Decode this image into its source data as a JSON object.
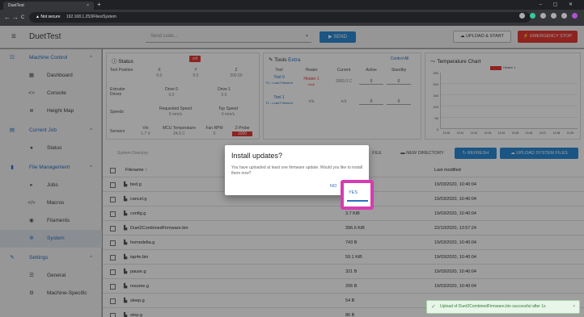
{
  "browser": {
    "tab_title": "DuetTest",
    "tab_close": "×",
    "new_tab": "+",
    "window_controls": "– ▢ ✕",
    "nav_back": "←",
    "nav_forward": "→",
    "nav_reload": "C",
    "security": "▲ Not secure",
    "url": "192.168.1.253/Files/System"
  },
  "header": {
    "menu": "≡",
    "title": "DuetTest",
    "gcode_placeholder": "Send code...",
    "gcode_caret": "▾",
    "send_label": "▶ SEND",
    "upload_start_label": "☁ UPLOAD & START",
    "estop_label": "⚡ EMERGENCY STOP"
  },
  "sidebar": {
    "machine_control": "Machine Control",
    "dashboard": "Dashboard",
    "console": "Console",
    "height_map": "Height Map",
    "current_job": "Current Job",
    "status": "Status",
    "file_management": "File Management",
    "jobs": "Jobs",
    "macros": "Macros",
    "filaments": "Filaments",
    "system": "System",
    "settings": "Settings",
    "general": "General",
    "machine_specific": "Machine-Specific",
    "chev": "^"
  },
  "status_panel": {
    "title": "Status",
    "badge": "Off",
    "tool_position": "Tool Position",
    "x": "X",
    "y": "Y",
    "z": "Z",
    "x_val": "0.0",
    "y_val": "0.0",
    "z_val": "200.00",
    "extruder_drives": "Extruder Drives",
    "drive0": "Drive 0",
    "drive1": "Drive 1",
    "drive0_val": "0.0",
    "drive1_val": "0.0",
    "speeds": "Speeds",
    "requested_speed": "Requested Speed",
    "top_speed": "Top Speed",
    "req_val": "0 mm/s",
    "top_val": "0 mm/s",
    "sensors": "Sensors",
    "vin": "Vin",
    "mcu": "MCU Temperature",
    "fan": "Fan RPM",
    "zprobe": "Z-Probe",
    "vin_val": "1.7 V",
    "mcu_val": "24.0 C",
    "fan_val": "0",
    "zprobe_val": "1000"
  },
  "tools_panel": {
    "title": "Tools",
    "extra": "Extra",
    "control_all": "Control All",
    "h_tool": "Tool",
    "h_heater": "Heater",
    "h_current": "Current",
    "h_active": "Active",
    "h_standby": "Standby",
    "t0": "Tool 0",
    "t0_sub": "T0 - Load Filament",
    "t0_heater": "Heater 1",
    "t0_heater_sub": "fault",
    "t0_current": "2000.0 C",
    "t0_active": "0",
    "t0_standby": "0",
    "t1": "Tool 1",
    "t1_sub": "T1 - Load Filament",
    "t1_heater": "n/a",
    "t1_current": "n/a",
    "t1_active": "0",
    "t1_standby": "0"
  },
  "chart_panel": {
    "title": "Temperature Chart",
    "legend": "Heater 1",
    "y_ticks": [
      "250",
      "200",
      "150",
      "100",
      "50",
      "0"
    ],
    "x_ticks": [
      "13:30",
      "13:31",
      "13:32",
      "13:33",
      "13:34",
      "13:35",
      "13:36",
      "13:37",
      "13:38",
      "13:39"
    ]
  },
  "files": {
    "dir_label": "System Directory",
    "new_file": "FILE",
    "new_dir": "NEW DIRECTORY",
    "refresh": "REFRESH",
    "upload_system": "UPLOAD SYSTEM FILES",
    "col_name": "Filename ↑",
    "col_date": "Last modified",
    "rows": [
      {
        "name": "bed.g",
        "size": "",
        "date": "19/03/2020, 10:40:04"
      },
      {
        "name": "cancel.g",
        "size": "",
        "date": "19/03/2020, 10:40:04"
      },
      {
        "name": "config.g",
        "size": "3.7 KiB",
        "date": "19/03/2020, 10:40:04"
      },
      {
        "name": "Duet2CombinedFirmware.bin",
        "size": "396.6 KiB",
        "date": "22/10/2020, 13:57:24"
      },
      {
        "name": "homedelta.g",
        "size": "743 B",
        "date": "19/03/2020, 10:40:04"
      },
      {
        "name": "iap4e.bin",
        "size": "59.1 KiB",
        "date": "19/03/2020, 10:40:04"
      },
      {
        "name": "pause.g",
        "size": "321 B",
        "date": "19/03/2020, 10:40:04"
      },
      {
        "name": "resume.g",
        "size": "206 B",
        "date": "19/03/2020, 10:40:04"
      },
      {
        "name": "sleep.g",
        "size": "54 B",
        "date": ""
      },
      {
        "name": "stop.g",
        "size": "86 B",
        "date": ""
      }
    ]
  },
  "dialog": {
    "title": "Install updates?",
    "text": "You have uploaded at least one firmware update. Would you like to install them now?",
    "no": "NO",
    "yes": "YES"
  },
  "toast": {
    "ok_icon": "✓",
    "text": "Upload of Duet2CombinedFirmware.bin successful after 1s",
    "close": "×"
  },
  "colors": {
    "accent": "#2a6fc2",
    "highlight": "#d63cb0",
    "estop": "#e53935"
  }
}
